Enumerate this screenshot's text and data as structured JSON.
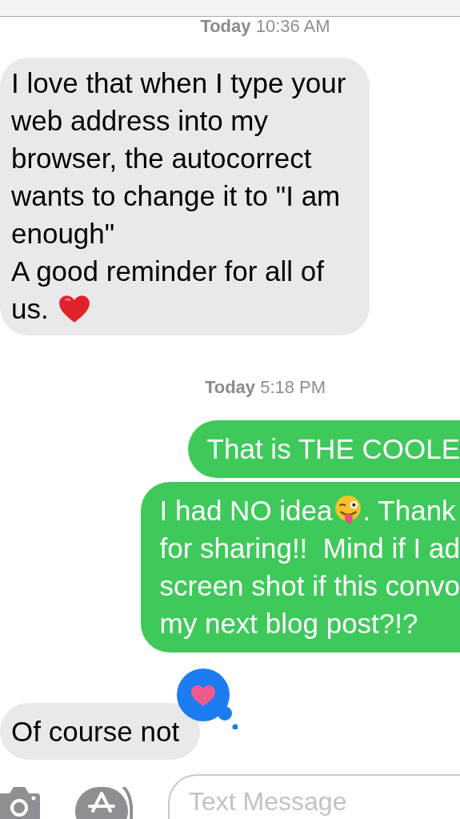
{
  "conversation": [
    {
      "kind": "timestamp",
      "day": "Today",
      "time": "10:36 AM"
    },
    {
      "kind": "incoming",
      "blocks": [
        [
          {
            "kind": "text",
            "text": "I love that when I type your\nweb address into my\nbrowser, the autocorrect\nwants to change it to \"I am\nenough\"\nA good reminder for all of"
          }
        ],
        [
          {
            "kind": "text",
            "text": "us."
          },
          {
            "kind": "heart"
          }
        ]
      ]
    },
    {
      "kind": "timestamp",
      "day": "Today",
      "time": "5:18 PM"
    },
    {
      "kind": "outgoing",
      "blocks": [
        [
          {
            "kind": "text",
            "text": "That is THE COOLE"
          }
        ]
      ]
    },
    {
      "kind": "outgoing",
      "blocks": [
        [
          {
            "kind": "text",
            "text": "I had NO idea"
          },
          {
            "kind": "wink"
          },
          {
            "kind": "text",
            "text": ". Thank"
          }
        ],
        [
          {
            "kind": "text",
            "text": "for sharing!!  Mind if I ad\nscreen shot if this convo\nmy next blog post?!?"
          }
        ]
      ]
    },
    {
      "kind": "incoming",
      "reacted": true,
      "blocks": [
        [
          {
            "kind": "text",
            "text": "Of course not"
          }
        ]
      ]
    }
  ],
  "compose_bar": {
    "placeholder": "Text Message"
  }
}
